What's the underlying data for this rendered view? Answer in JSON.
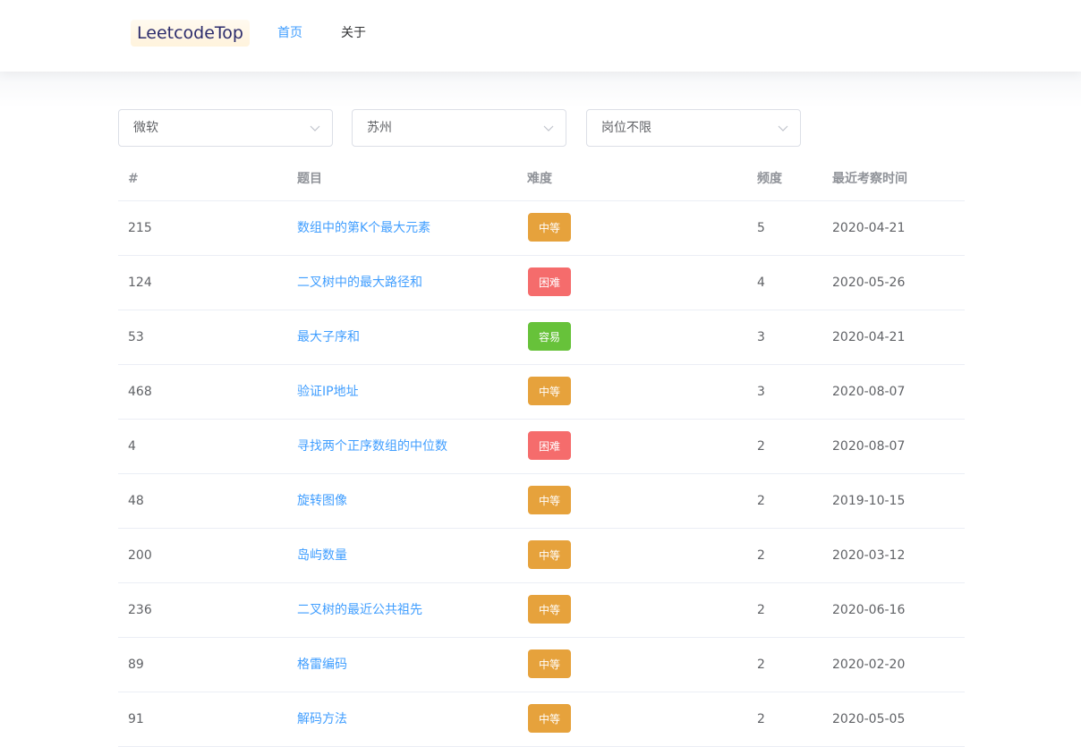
{
  "header": {
    "logo": "LeetcodeTop",
    "nav": [
      {
        "label": "首页",
        "active": true
      },
      {
        "label": "关于",
        "active": false
      }
    ]
  },
  "filters": {
    "company": "微软",
    "city": "苏州",
    "position": "岗位不限"
  },
  "table": {
    "columns": [
      "#",
      "题目",
      "难度",
      "频度",
      "最近考察时间"
    ],
    "rows": [
      {
        "id": "215",
        "title": "数组中的第K个最大元素",
        "difficulty": "中等",
        "level": "medium",
        "frequency": "5",
        "date": "2020-04-21"
      },
      {
        "id": "124",
        "title": "二叉树中的最大路径和",
        "difficulty": "困难",
        "level": "hard",
        "frequency": "4",
        "date": "2020-05-26"
      },
      {
        "id": "53",
        "title": "最大子序和",
        "difficulty": "容易",
        "level": "easy",
        "frequency": "3",
        "date": "2020-04-21"
      },
      {
        "id": "468",
        "title": "验证IP地址",
        "difficulty": "中等",
        "level": "medium",
        "frequency": "3",
        "date": "2020-08-07"
      },
      {
        "id": "4",
        "title": "寻找两个正序数组的中位数",
        "difficulty": "困难",
        "level": "hard",
        "frequency": "2",
        "date": "2020-08-07"
      },
      {
        "id": "48",
        "title": "旋转图像",
        "difficulty": "中等",
        "level": "medium",
        "frequency": "2",
        "date": "2019-10-15"
      },
      {
        "id": "200",
        "title": "岛屿数量",
        "difficulty": "中等",
        "level": "medium",
        "frequency": "2",
        "date": "2020-03-12"
      },
      {
        "id": "236",
        "title": "二叉树的最近公共祖先",
        "difficulty": "中等",
        "level": "medium",
        "frequency": "2",
        "date": "2020-06-16"
      },
      {
        "id": "89",
        "title": "格雷编码",
        "difficulty": "中等",
        "level": "medium",
        "frequency": "2",
        "date": "2020-02-20"
      },
      {
        "id": "91",
        "title": "解码方法",
        "difficulty": "中等",
        "level": "medium",
        "frequency": "2",
        "date": "2020-05-05"
      }
    ]
  },
  "colors": {
    "primary": "#409eff",
    "medium": "#e6a23c",
    "hard": "#f56c6c",
    "easy": "#67c23a"
  },
  "icons": {
    "select_arrow": "chevron-down-icon"
  }
}
